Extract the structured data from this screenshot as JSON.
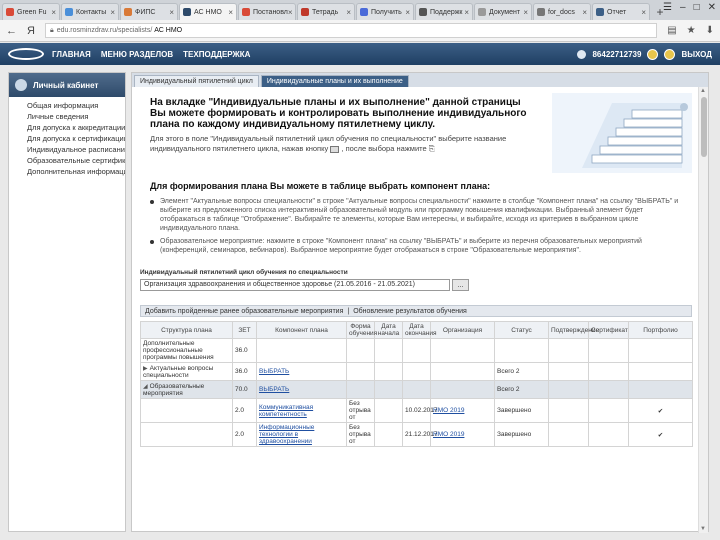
{
  "browser": {
    "tabs": [
      {
        "title": "Green Fu",
        "color": "#d94a38"
      },
      {
        "title": "Контакты",
        "color": "#4a8fd9"
      },
      {
        "title": "ФИПС",
        "color": "#d97a38"
      },
      {
        "title": "АС НМО",
        "color": "#2e4a6a",
        "active": true
      },
      {
        "title": "Постановл",
        "color": "#d94a38"
      },
      {
        "title": "Тетрадь",
        "color": "#c0392b"
      },
      {
        "title": "Получить",
        "color": "#4a6ad9"
      },
      {
        "title": "Поддержк",
        "color": "#555555"
      },
      {
        "title": "Документ",
        "color": "#9a9a9a"
      },
      {
        "title": "for_docs",
        "color": "#777777"
      },
      {
        "title": "Отчет",
        "color": "#3c5f86"
      }
    ],
    "new_tab": "+",
    "address_prefix": "edu.rosminzdrav.ru/specialists/",
    "address_host": "АС НМО"
  },
  "site": {
    "nav": [
      "ГЛАВНАЯ",
      "МЕНЮ РАЗДЕЛОВ",
      "ТЕХПОДДЕРЖКА"
    ],
    "phone": "86422712739",
    "exit": "ВЫХОД"
  },
  "sidebar": {
    "title": "Личный кабинет",
    "items": [
      "Общая информация",
      "Личные сведения",
      "Для допуска к аккредитации",
      "Для допуска к сертификации",
      "Индивидуальное расписание",
      "Образовательные сертификаты",
      "Дополнительная информация"
    ]
  },
  "page_tabs": [
    {
      "label": "Индивидуальный пятилетний цикл"
    },
    {
      "label": "Индивидуальные планы и их выполнение",
      "active": true
    }
  ],
  "intro": {
    "title": "На вкладке \"Индивидуальные планы и их выполнение\" данной страницы Вы можете формировать и контролировать выполнение индивидуального плана по каждому индивидуальному пятилетнему циклу.",
    "text_1": "Для этого в поле \"Индивидуальный пятилетний цикл обучения по специальности\" выберите название индивидуального пятилетнего цикла, нажав кнопку",
    "text_2": ", после выбора нажмите"
  },
  "section": {
    "title": "Для формирования плана Вы можете в таблице выбрать компонент плана:",
    "bullets": [
      "Элемент \"Актуальные вопросы специальности\" в строке \"Актуальные вопросы специальности\" нажмите в столбце \"Компонент плана\" на ссылку \"ВЫБРАТЬ\" и выберите из предложенного списка интерактивный образовательный модуль или программу повышения квалификации. Выбранный элемент будет отображаться в таблице \"Отображение\". Выбирайте те элементы, которые Вам интересны, и выбирайте, исходя из критериев в выбранном цикле индивидуального плана.",
      "Образовательное мероприятие: нажмите в строке \"Компонент плана\" на ссылку \"ВЫБРАТЬ\" и выберите из перечня образовательных мероприятий (конференций, семинаров, вебинаров). Выбранное мероприятие будет отображаться в строке \"Образовательные мероприятия\"."
    ]
  },
  "cycle": {
    "label": "Индивидуальный пятилетний цикл обучения по специальности",
    "value": "Организация здравоохранения и общественное здоровье (21.05.2016 - 21.05.2021)",
    "button": "..."
  },
  "actions": {
    "add_label": "Добавить пройденные ранее образовательные мероприятия",
    "separator": "|",
    "update_label": "Обновление результатов обучения"
  },
  "table": {
    "columns": [
      "Структура плана",
      "ЗЕТ",
      "Компонент плана",
      "Форма обучения",
      "Дата начала",
      "Дата окончания",
      "Организация",
      "Статус",
      "Подтверждение",
      "Сертификат",
      "Портфолио"
    ],
    "rows": [
      {
        "kind": "header",
        "structure": "Дополнительные профессиональные программы повышения",
        "zet": "36.0",
        "component": "",
        "form": "",
        "start": "",
        "end": "",
        "org": "",
        "status": "",
        "check": ""
      },
      {
        "kind": "group",
        "structure": "Актуальные вопросы специальности",
        "zet": "36.0",
        "component": "ВЫБРАТЬ",
        "form": "",
        "start": "",
        "end": "",
        "org": "",
        "status": "Всего 2",
        "check": "",
        "collapsed": true
      },
      {
        "kind": "group",
        "structure": "Образовательные мероприятия",
        "zet": "70.0",
        "component": "ВЫБРАТЬ",
        "form": "",
        "start": "",
        "end": "",
        "org": "",
        "status": "Всего 2",
        "check": "",
        "shade": true
      },
      {
        "kind": "item",
        "structure": "",
        "zet": "2.0",
        "component": "Коммуникативная компетентность",
        "form": "Без отрыва от",
        "start": "",
        "end": "10.02.2017",
        "org": "НМО 2019",
        "status": "Завершено",
        "check": "✔"
      },
      {
        "kind": "item",
        "structure": "",
        "zet": "2.0",
        "component": "Информационные технологии в здравоохранении",
        "form": "Без отрыва от",
        "start": "",
        "end": "21.12.2017",
        "org": "НМО 2019",
        "status": "Завершено",
        "check": "✔"
      }
    ]
  },
  "colors": {
    "header_blue": "#2e4a6a",
    "link": "#1f4fa1",
    "check_green": "#3b9a3b"
  }
}
